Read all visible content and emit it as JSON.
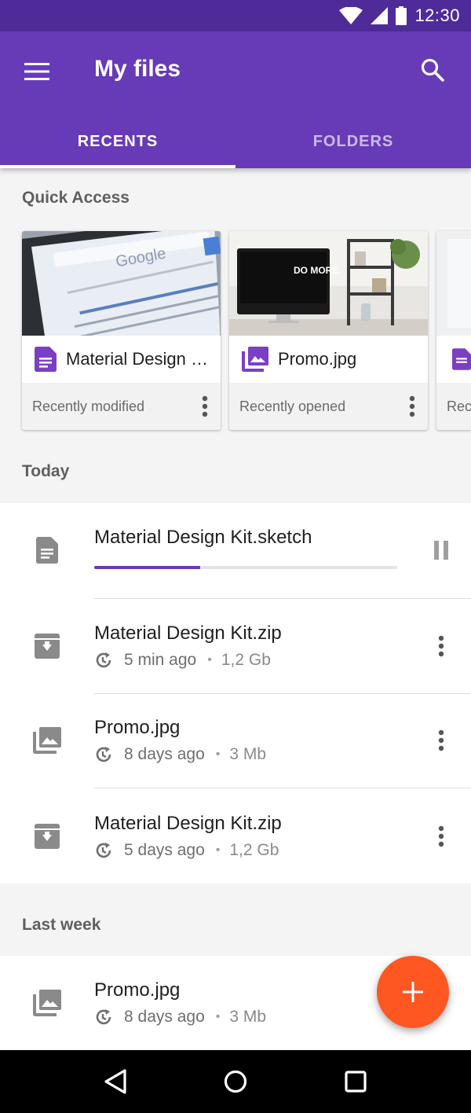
{
  "status_bar": {
    "time": "12:30",
    "icons": [
      "wifi-icon",
      "signal-icon",
      "battery-icon"
    ]
  },
  "app_bar": {
    "title": "My files",
    "menu_icon": "menu-icon",
    "search_icon": "search-icon"
  },
  "tabs": [
    {
      "label": "RECENTS",
      "active": true
    },
    {
      "label": "FOLDERS",
      "active": false
    }
  ],
  "quick_access": {
    "heading": "Quick Access",
    "cards": [
      {
        "title": "Material Design Kit.sketch",
        "subtitle": "Recently modified",
        "icon": "document-icon",
        "thumb_text": "Google"
      },
      {
        "title": "Promo.jpg",
        "subtitle": "Recently opened",
        "icon": "image-icon",
        "thumb_text": "DO MORE."
      },
      {
        "title": "",
        "subtitle": "Rec",
        "icon": "document-icon"
      }
    ]
  },
  "today": {
    "heading": "Today",
    "items": [
      {
        "name": "Material Design Kit.sketch",
        "icon": "document-icon",
        "progress": 0.35,
        "action": "pause-icon"
      },
      {
        "name": "Material Design Kit.zip",
        "icon": "archive-icon",
        "time": "5 min ago",
        "size": "1,2 Gb",
        "action": "more-vert-icon"
      },
      {
        "name": "Promo.jpg",
        "icon": "image-icon",
        "time": "8 days ago",
        "size": "3 Mb",
        "action": "more-vert-icon"
      },
      {
        "name": "Material Design Kit.zip",
        "icon": "archive-icon",
        "time": "5 days ago",
        "size": "1,2 Gb",
        "action": "more-vert-icon"
      }
    ]
  },
  "last_week": {
    "heading": "Last week",
    "items": [
      {
        "name": "Promo.jpg",
        "icon": "image-icon",
        "time": "8 days ago",
        "size": "3 Mb"
      }
    ]
  },
  "fab": {
    "icon": "add-icon"
  },
  "nav_bar": {
    "buttons": [
      "back-icon",
      "home-icon",
      "recents-icon"
    ]
  },
  "colors": {
    "primary": "#673ab7",
    "primary_dark": "#4f2b9a",
    "accent": "#ff5722"
  }
}
